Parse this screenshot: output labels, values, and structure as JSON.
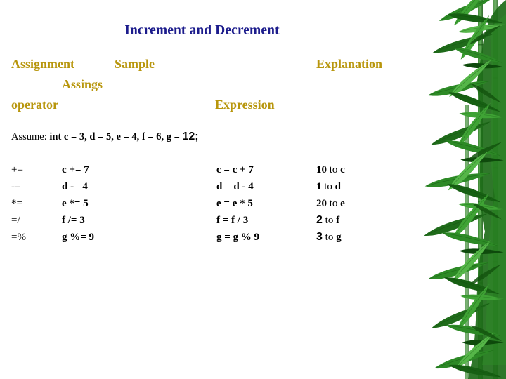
{
  "slide": {
    "title": "Increment and Decrement",
    "background_color": "#ffffff",
    "title_color": "#1c1c8c",
    "header_color": "#b8960c",
    "body_color": "#000000"
  },
  "headers": {
    "assignment": "Assignment",
    "operator": "operator",
    "sample": "Sample",
    "assings": "Assings",
    "expression": "Expression",
    "explanation": "Explanation"
  },
  "assume": {
    "label": "Assume:",
    "declaration": "int c = 3, d = 5, e = 4, f = 6, g =",
    "last_value": "12;"
  },
  "table": {
    "rows": [
      {
        "operator": "+=",
        "sample": "c += 7",
        "expansion": "c = c + 7",
        "result_value": "10",
        "result_tail": " to ",
        "result_var": "c",
        "value_font": "serif"
      },
      {
        "operator": "-=",
        "sample": "d -= 4",
        "expansion": "d = d - 4",
        "result_value": "1",
        "result_tail": " to ",
        "result_var": "d",
        "value_font": "serif"
      },
      {
        "operator": "*=",
        "sample": "e *= 5",
        "expansion": "e = e * 5",
        "result_value": "20",
        "result_tail": " to ",
        "result_var": "e",
        "value_font": "serif"
      },
      {
        "operator": "=/",
        "sample": "f /= 3",
        "expansion": "f = f / 3",
        "result_value": "2",
        "result_tail": " to ",
        "result_var": "f",
        "value_font": "sans"
      },
      {
        "operator": "=%",
        "sample": "g %= 9",
        "expansion": "g = g % 9",
        "result_value": "3",
        "result_tail": " to ",
        "result_var": "g",
        "value_font": "sans"
      }
    ]
  },
  "decoration": {
    "name": "bamboo-plant-image",
    "leaf_colors": [
      "#1f6b1a",
      "#2d8a26",
      "#3fa335",
      "#176013",
      "#55b648",
      "#0e4a0c"
    ]
  }
}
